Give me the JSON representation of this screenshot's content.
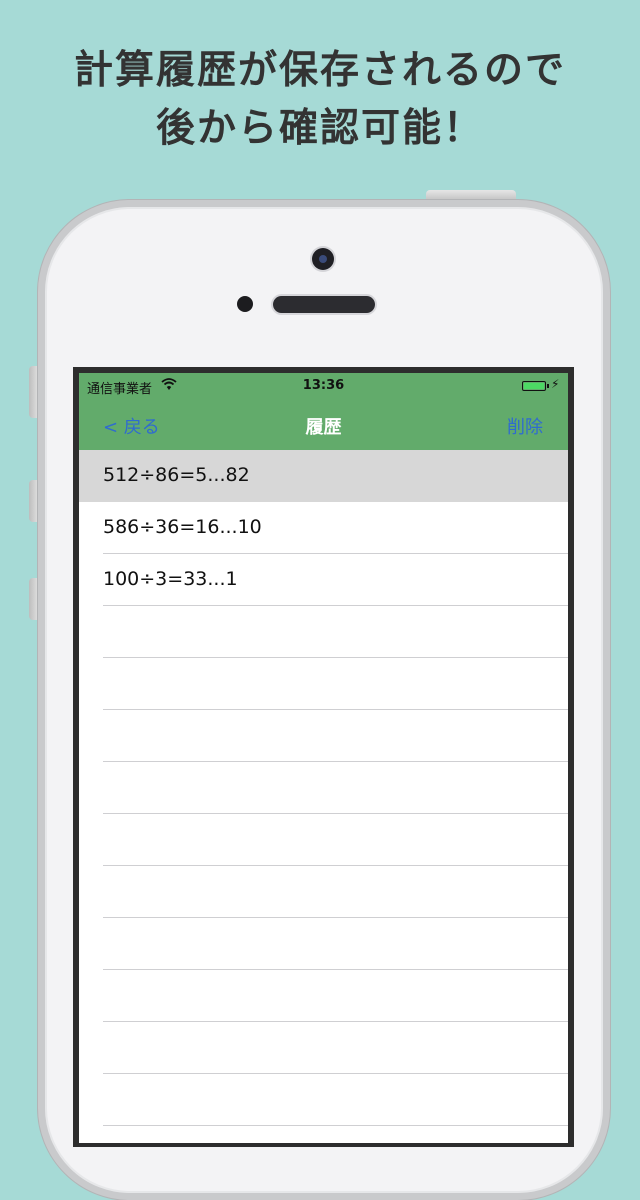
{
  "headline": {
    "line1": "計算履歴が保存されるので",
    "line2": "後から確認可能！"
  },
  "status_bar": {
    "carrier": "通信事業者",
    "time": "13:36",
    "wifi_icon": "wifi-icon",
    "battery_icon": "battery-icon",
    "charging_icon": "charging-bolt-icon"
  },
  "navbar": {
    "back_label": "< 戻る",
    "title": "履歴",
    "delete_label": "削除"
  },
  "history": [
    {
      "expression": "512÷86=5...82",
      "selected": true
    },
    {
      "expression": "586÷36=16...10",
      "selected": false
    },
    {
      "expression": "100÷3=33...1",
      "selected": false
    },
    {
      "expression": "",
      "selected": false
    },
    {
      "expression": "",
      "selected": false
    },
    {
      "expression": "",
      "selected": false
    },
    {
      "expression": "",
      "selected": false
    },
    {
      "expression": "",
      "selected": false
    },
    {
      "expression": "",
      "selected": false
    },
    {
      "expression": "",
      "selected": false
    },
    {
      "expression": "",
      "selected": false
    },
    {
      "expression": "",
      "selected": false
    },
    {
      "expression": "",
      "selected": false
    },
    {
      "expression": "",
      "selected": false
    }
  ],
  "colors": {
    "background": "#a6dad6",
    "navbar": "#62ab6b",
    "nav_button": "#2f6bd0",
    "selected_row": "#d7d7d7"
  }
}
